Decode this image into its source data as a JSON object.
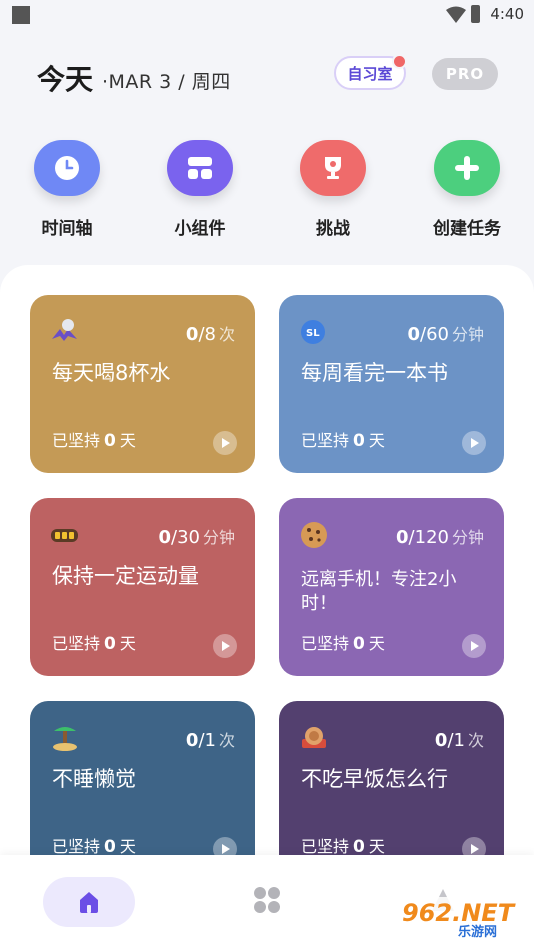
{
  "status": {
    "time": "4:40"
  },
  "header": {
    "today": "今天",
    "date": "·MAR 3 / 周四",
    "study_room_label": "自习室",
    "pro_label": "PRO"
  },
  "quick_actions": [
    {
      "label": "时间轴",
      "icon": "clock-icon",
      "color": "#6f88f5"
    },
    {
      "label": "小组件",
      "icon": "widget-icon",
      "color": "#7a63ee"
    },
    {
      "label": "挑战",
      "icon": "trophy-icon",
      "color": "#ef6b6b"
    },
    {
      "label": "创建任务",
      "icon": "plus-icon",
      "color": "#4ccf7e"
    }
  ],
  "tasks": [
    {
      "title": "每天喝8杯水",
      "done": "0",
      "target": "8",
      "unit": "次",
      "streak_prefix": "已坚持",
      "streak_days": "0",
      "streak_suffix": "天",
      "color": "#c49a56",
      "icon": "sleeping-bat-icon"
    },
    {
      "title": "每周看完一本书",
      "done": "0",
      "target": "60",
      "unit": "分钟",
      "streak_prefix": "已坚持",
      "streak_days": "0",
      "streak_suffix": "天",
      "color": "#6c93c6",
      "icon": "sl-badge-icon"
    },
    {
      "title": "保持一定运动量",
      "done": "0",
      "target": "30",
      "unit": "分钟",
      "streak_prefix": "已坚持",
      "streak_days": "0",
      "streak_suffix": "天",
      "color": "#bd6262",
      "icon": "battery-icon"
    },
    {
      "title": "远离手机！专注2小时！",
      "done": "0",
      "target": "120",
      "unit": "分钟",
      "streak_prefix": "已坚持",
      "streak_days": "0",
      "streak_suffix": "天",
      "color": "#8b67b3",
      "icon": "cookie-icon"
    },
    {
      "title": "不睡懒觉",
      "done": "0",
      "target": "1",
      "unit": "次",
      "streak_prefix": "已坚持",
      "streak_days": "0",
      "streak_suffix": "天",
      "color": "#3e6487",
      "icon": "island-icon"
    },
    {
      "title": "不吃早饭怎么行",
      "done": "0",
      "target": "1",
      "unit": "次",
      "streak_prefix": "已坚持",
      "streak_days": "0",
      "streak_suffix": "天",
      "color": "#53406f",
      "icon": "medal-icon"
    }
  ],
  "nav": {
    "home_icon": "home-icon",
    "grid_icon": "grid-icon"
  },
  "watermark": {
    "big": "962.NET",
    "small": "乐游网"
  }
}
